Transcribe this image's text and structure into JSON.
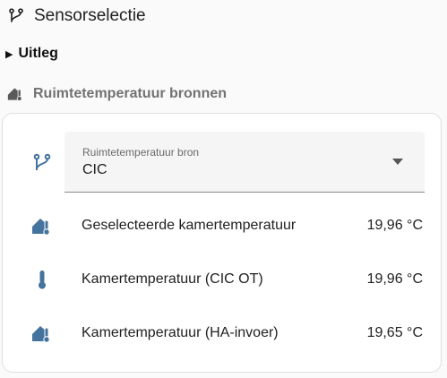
{
  "header": {
    "title": "Sensorselectie",
    "icon": "source-branch-icon"
  },
  "details": {
    "summary": "Uitleg",
    "expanded": false
  },
  "section": {
    "title": "Ruimtetemperatuur bronnen",
    "icon": "home-thermometer-icon"
  },
  "colors": {
    "icon_blue": "#44739e",
    "section_gray": "#727272"
  },
  "select": {
    "label": "Ruimtetemperatuur bron",
    "value": "CIC",
    "icon": "source-branch-icon"
  },
  "rows": [
    {
      "label": "Geselecteerde kamertemperatuur",
      "value": "19,96 °C",
      "icon": "home-thermometer-icon"
    },
    {
      "label": "Kamertemperatuur (CIC OT)",
      "value": "19,96 °C",
      "icon": "thermometer-icon"
    },
    {
      "label": "Kamertemperatuur (HA-invoer)",
      "value": "19,65 °C",
      "icon": "home-thermometer-icon"
    }
  ]
}
